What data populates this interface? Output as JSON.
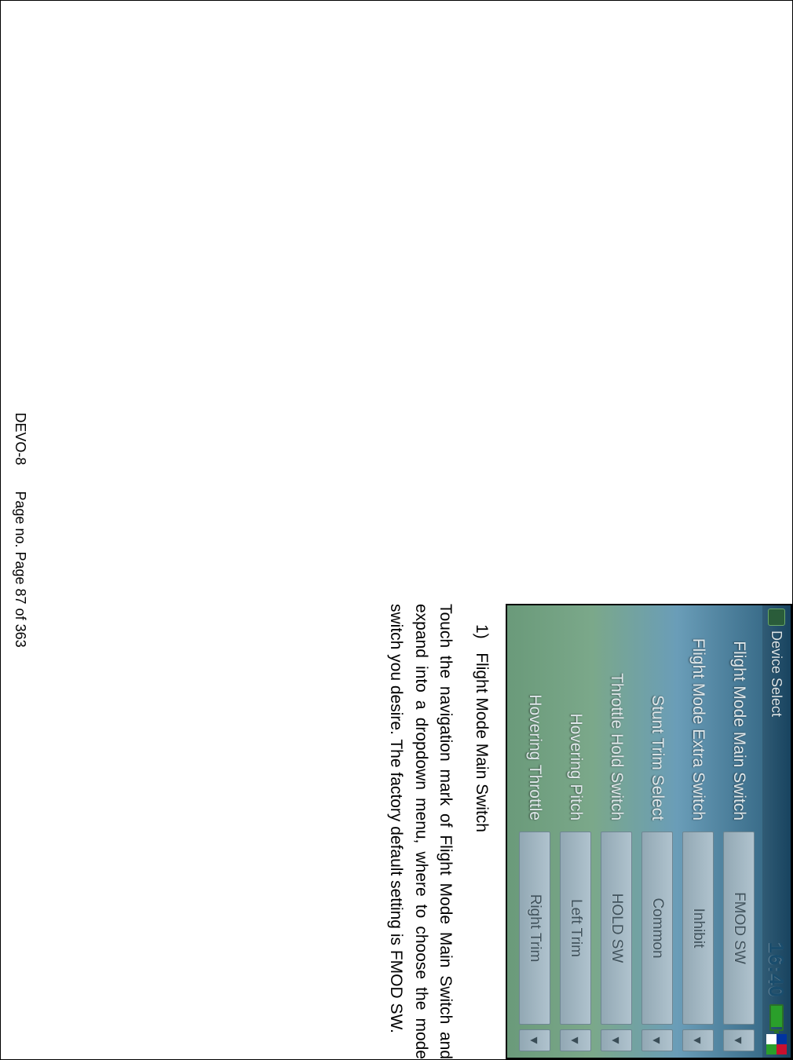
{
  "screenshot": {
    "titlebar": {
      "title": "Device Select",
      "clock": "16:40"
    },
    "rows": [
      {
        "label": "Flight Mode Main Switch",
        "value": "FMOD SW"
      },
      {
        "label": "Flight Mode Extra Switch",
        "value": "Inhibit"
      },
      {
        "label": "Stunt Trim Select",
        "value": "Common"
      },
      {
        "label": "Throttle Hold Switch",
        "value": "HOLD SW"
      },
      {
        "label": "Hovering Pitch",
        "value": "Left Trim"
      },
      {
        "label": "Hovering Throttle",
        "value": "Right Trim"
      }
    ]
  },
  "text": {
    "heading_num": "1)",
    "heading": "Flight Mode Main Switch",
    "body": "Touch the navigation mark of Flight Mode Main Switch and expand into a dropdown menu, where to choose the mode switch you desire. The factory default setting is FMOD SW."
  },
  "footer": {
    "model": "DEVO-8",
    "page": "Page no. Page 87 of 363"
  }
}
